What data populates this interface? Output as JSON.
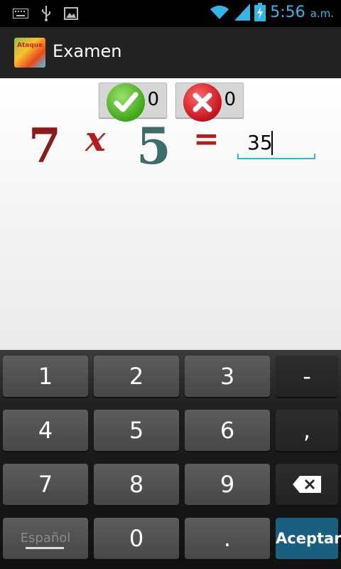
{
  "status_bar": {
    "time": "5:56",
    "ampm": "a.m.",
    "icons": [
      "keyboard-icon",
      "usb-icon",
      "image-icon",
      "wifi-icon",
      "signal-icon",
      "battery-charging-icon"
    ]
  },
  "action_bar": {
    "title": "Examen",
    "icon_text": "Ataque"
  },
  "scores": {
    "correct": "0",
    "wrong": "0"
  },
  "equation": {
    "operand_a": "7",
    "operator": "x",
    "operand_b": "5",
    "equals": "="
  },
  "answer": {
    "value": "35"
  },
  "keyboard": {
    "row1": [
      "1",
      "2",
      "3",
      "-"
    ],
    "row2": [
      "4",
      "5",
      "6",
      ","
    ],
    "row3": [
      "7",
      "8",
      "9"
    ],
    "row4": [
      "Español",
      "0",
      ".",
      "Aceptar"
    ]
  },
  "colors": {
    "accent": "#33b5e5",
    "accept_key": "#1a5f7f",
    "correct": "#3fa51a",
    "wrong": "#c4121c"
  }
}
